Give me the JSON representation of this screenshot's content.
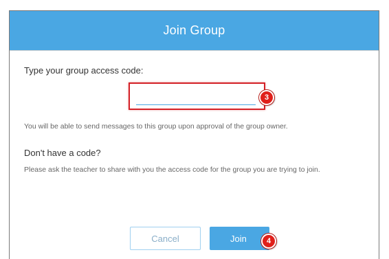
{
  "dialog": {
    "title": "Join Group",
    "prompt_label": "Type your group access code:",
    "code_input": {
      "value": "",
      "placeholder": ""
    },
    "approval_note": "You will be able to send messages to this group upon approval of the group owner.",
    "no_code_heading": "Don't have a code?",
    "no_code_text": "Please ask the teacher to share with you the access code for the group you are trying to join.",
    "cancel_label": "Cancel",
    "join_label": "Join"
  },
  "annotations": {
    "step_input": "3",
    "step_join": "4"
  },
  "colors": {
    "header": "#4aa7e3",
    "highlight": "#d42026",
    "badge": "#e0201b"
  }
}
